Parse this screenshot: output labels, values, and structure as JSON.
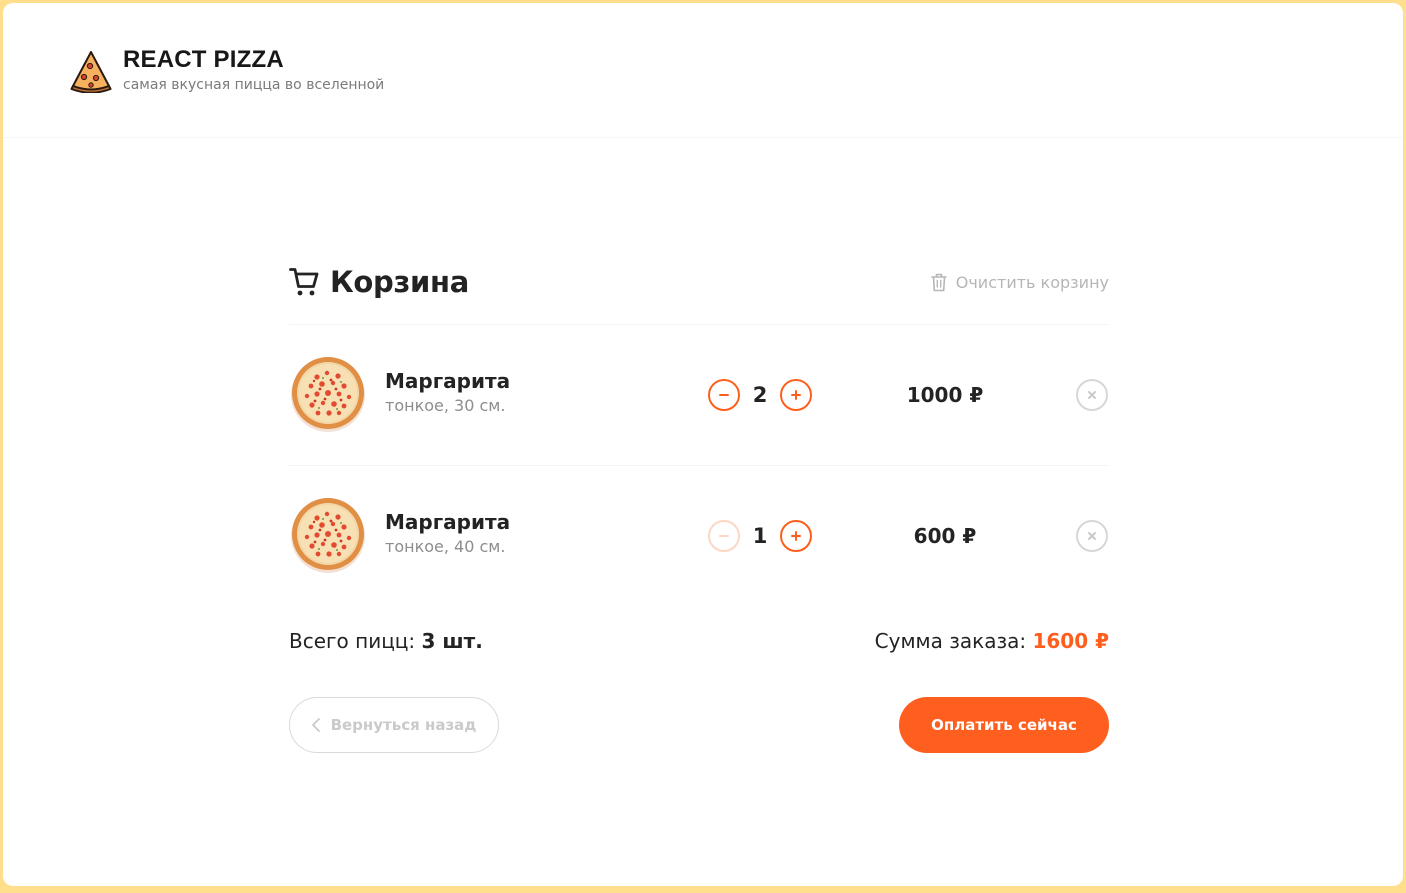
{
  "header": {
    "title": "REACT PIZZA",
    "subtitle": "самая вкусная пицца во вселенной",
    "logo_icon": "pizza-slice-icon"
  },
  "cart": {
    "title": "Корзина",
    "title_icon": "cart-icon",
    "clear_label": "Очистить корзину",
    "clear_icon": "trash-icon",
    "items": [
      {
        "name": "Маргарита",
        "desc": "тонкое, 30 см.",
        "count": "2",
        "price": "1000 ₽",
        "minus_disabled": false
      },
      {
        "name": "Маргарита",
        "desc": "тонкое, 40 см.",
        "count": "1",
        "price": "600 ₽",
        "minus_disabled": true
      }
    ],
    "total_label": "Всего пицц:",
    "total_value": "3 шт.",
    "sum_label": "Сумма заказа:",
    "sum_value": "1600 ₽",
    "back_label": "Вернуться назад",
    "pay_label": "Оплатить сейчас"
  },
  "colors": {
    "accent": "#fe5f1e",
    "page_border": "#ffdf8c",
    "muted": "#b6b6b6"
  }
}
